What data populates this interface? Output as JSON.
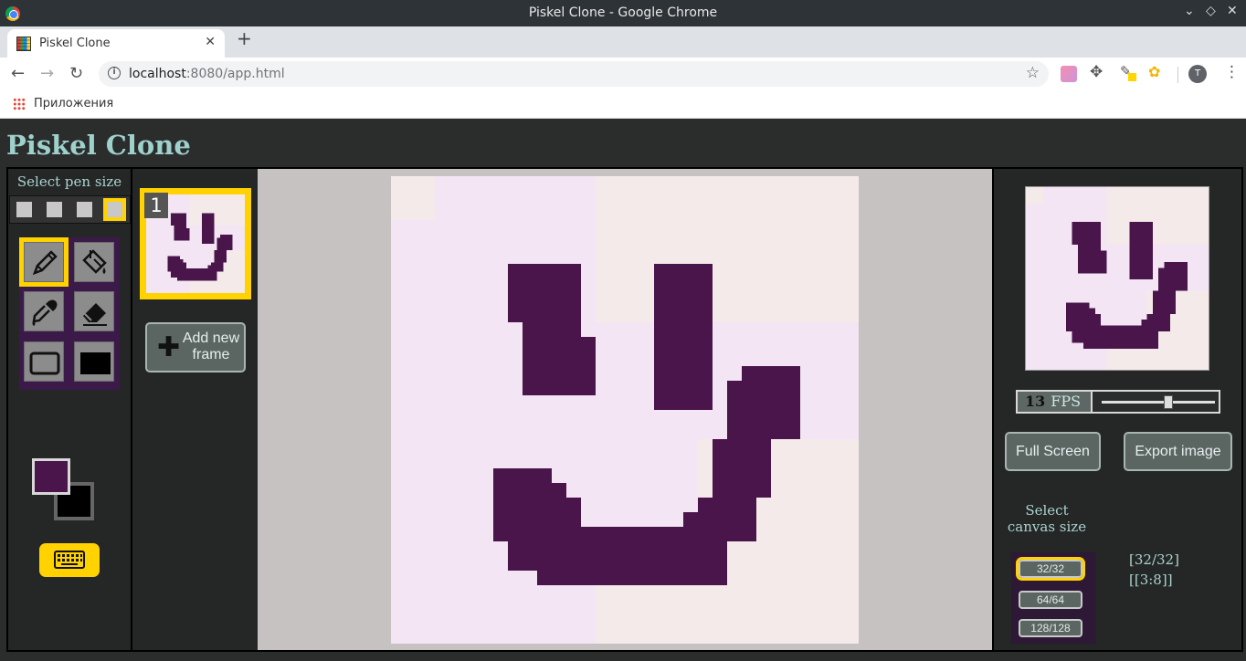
{
  "window": {
    "title": "Piskel Clone - Google Chrome"
  },
  "tab": {
    "title": "Piskel Clone",
    "close": "✕",
    "new": "+"
  },
  "address": {
    "host": "localhost",
    "rest": ":8080/app.html"
  },
  "profile": {
    "initial": "T"
  },
  "bookmarks": {
    "apps_label": "Приложения"
  },
  "app": {
    "title": "Piskel Clone",
    "pen_size_label": "Select pen size",
    "pen_sizes": [
      1,
      2,
      3,
      4
    ],
    "pen_size_selected": 4,
    "tools": [
      "pen-tool",
      "paint-bucket-tool",
      "color-picker-tool",
      "eraser-tool",
      "stroke-rectangle-tool",
      "fill-rectangle-tool"
    ],
    "tool_selected": "pen-tool",
    "colors": {
      "primary": "#4a154b",
      "secondary": "#000000",
      "accent": "#ffd200",
      "canvas_bg": "#f3e5f3"
    }
  },
  "frames": {
    "items": [
      {
        "number": "1"
      }
    ],
    "add_label_line1": "Add new",
    "add_label_line2": "frame"
  },
  "preview": {
    "fps_value": "13",
    "fps_unit": "FPS",
    "fps_slider_fraction": 0.6,
    "full_screen_label": "Full Screen",
    "export_label": "Export image"
  },
  "canvas_size": {
    "label_line1": "Select",
    "label_line2": "canvas size",
    "options": [
      "32/32",
      "64/64",
      "128/128"
    ],
    "selected": "32/32",
    "info_size": "[32/32]",
    "info_cursor": "[[3:8]]"
  }
}
